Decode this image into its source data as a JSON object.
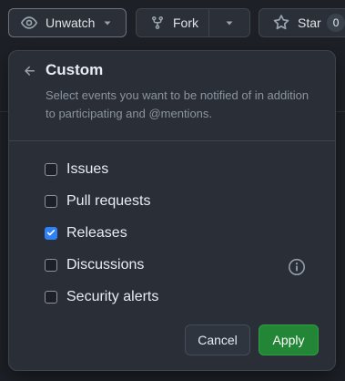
{
  "toolbar": {
    "unwatch_label": "Unwatch",
    "fork_label": "Fork",
    "star_label": "Star",
    "star_count": "0"
  },
  "panel": {
    "title": "Custom",
    "description": "Select events you want to be notified of in addition to participating and @mentions.",
    "options": [
      {
        "label": "Issues",
        "checked": false
      },
      {
        "label": "Pull requests",
        "checked": false
      },
      {
        "label": "Releases",
        "checked": true
      },
      {
        "label": "Discussions",
        "checked": false
      },
      {
        "label": "Security alerts",
        "checked": false
      }
    ],
    "cancel_label": "Cancel",
    "apply_label": "Apply"
  },
  "colors": {
    "checkbox_checked": "#2f81f7",
    "apply_button": "#238636",
    "panel_background": "#2a2f37",
    "page_background": "#1d2127"
  },
  "icons": [
    "eye-icon",
    "caret-down-icon",
    "fork-icon",
    "star-icon",
    "arrow-left-icon",
    "check-icon",
    "info-icon"
  ]
}
